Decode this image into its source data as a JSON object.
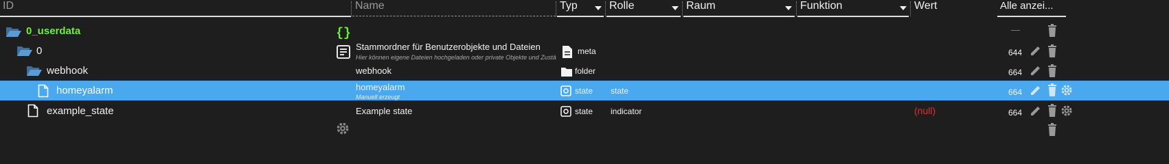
{
  "header": {
    "id": "ID",
    "name": "Name",
    "type": "Typ",
    "role": "Rolle",
    "room": "Raum",
    "function": "Funktion",
    "value": "Wert",
    "all": "Alle anzei..."
  },
  "rows": [
    {
      "id": "0_userdata",
      "name_icon": "curly-braces-icon",
      "acl": "—"
    },
    {
      "id": "0",
      "name": "Stammordner für Benutzerobjekte und Dateien",
      "desc": "Hier können eigene Dateien hochgeladen oder private Objekte und Zustände",
      "type": "meta",
      "acl": "644"
    },
    {
      "id": "webhook",
      "name": "webhook",
      "type": "folder",
      "acl": "664"
    },
    {
      "id": "homeyalarm",
      "name": "homeyalarm",
      "desc": "Manuell erzeugt",
      "type": "state",
      "role": "state",
      "acl": "664",
      "selected": true
    },
    {
      "id": "example_state",
      "name": "Example state",
      "type": "state",
      "role": "indicator",
      "value": "(null)",
      "acl": "664"
    }
  ],
  "colors": {
    "selected_row": "#4aa8ef",
    "green": "#6cf236",
    "null": "#e03131",
    "folder": "#5b9bd5"
  }
}
